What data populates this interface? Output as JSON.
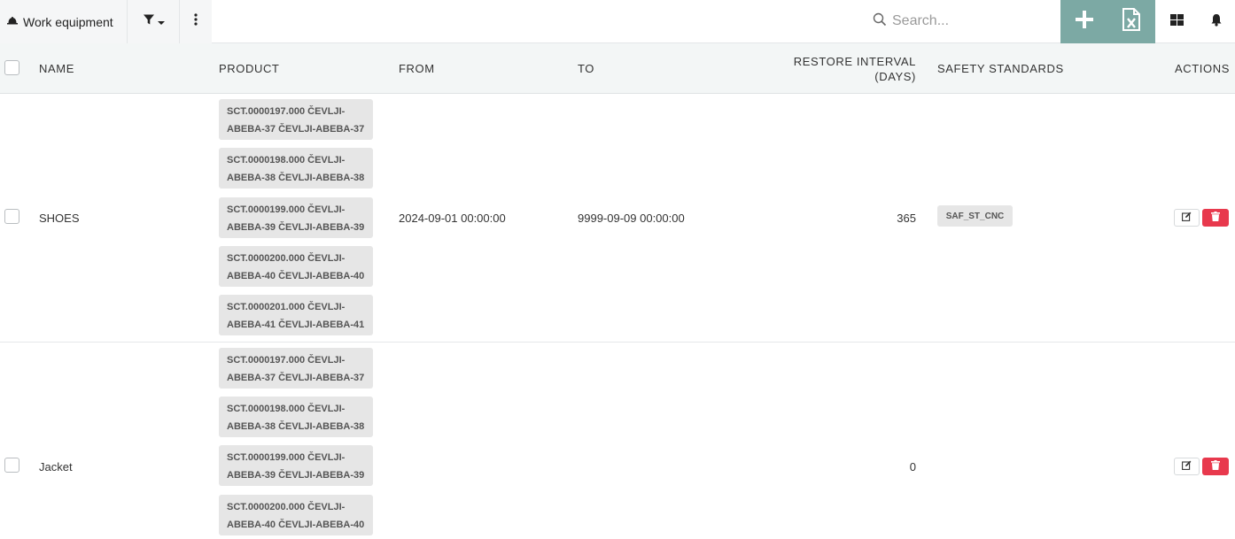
{
  "toolbar": {
    "title": "Work equipment",
    "search_placeholder": "Search...",
    "icons": {
      "title": "hard-hat-icon",
      "filter": "filter-icon",
      "more": "vertical-dots-icon",
      "search": "search-icon",
      "add": "plus-icon",
      "excel": "excel-export-icon",
      "layout": "grid-layout-icon",
      "notifications": "bell-icon"
    },
    "accent_color": "#7ca9a4"
  },
  "table": {
    "headers": {
      "name": "NAME",
      "product": "PRODUCT",
      "from": "FROM",
      "to": "TO",
      "restore_interval_1": "RESTORE INTERVAL",
      "restore_interval_2": "(DAYS)",
      "safety_standards": "SAFETY STANDARDS",
      "actions": "ACTIONS"
    },
    "rows": [
      {
        "name": "SHOES",
        "products": [
          [
            "SCT.0000197.000 ČEVLJI-",
            "ABEBA-37 ČEVLJI-ABEBA-37"
          ],
          [
            "SCT.0000198.000 ČEVLJI-",
            "ABEBA-38 ČEVLJI-ABEBA-38"
          ],
          [
            "SCT.0000199.000 ČEVLJI-",
            "ABEBA-39 ČEVLJI-ABEBA-39"
          ],
          [
            "SCT.0000200.000 ČEVLJI-",
            "ABEBA-40 ČEVLJI-ABEBA-40"
          ],
          [
            "SCT.0000201.000 ČEVLJI-",
            "ABEBA-41 ČEVLJI-ABEBA-41"
          ]
        ],
        "from": "2024-09-01 00:00:00",
        "to": "9999-09-09 00:00:00",
        "restore_interval": "365",
        "safety_standards": [
          "SAF_ST_CNC"
        ]
      },
      {
        "name": "Jacket",
        "products": [
          [
            "SCT.0000197.000 ČEVLJI-",
            "ABEBA-37 ČEVLJI-ABEBA-37"
          ],
          [
            "SCT.0000198.000 ČEVLJI-",
            "ABEBA-38 ČEVLJI-ABEBA-38"
          ],
          [
            "SCT.0000199.000 ČEVLJI-",
            "ABEBA-39 ČEVLJI-ABEBA-39"
          ],
          [
            "SCT.0000200.000 ČEVLJI-",
            "ABEBA-40 ČEVLJI-ABEBA-40"
          ]
        ],
        "from": "",
        "to": "",
        "restore_interval": "0",
        "safety_standards": []
      }
    ],
    "row_icons": {
      "edit": "edit-icon",
      "delete": "trash-icon"
    },
    "delete_color": "#e8394d"
  }
}
